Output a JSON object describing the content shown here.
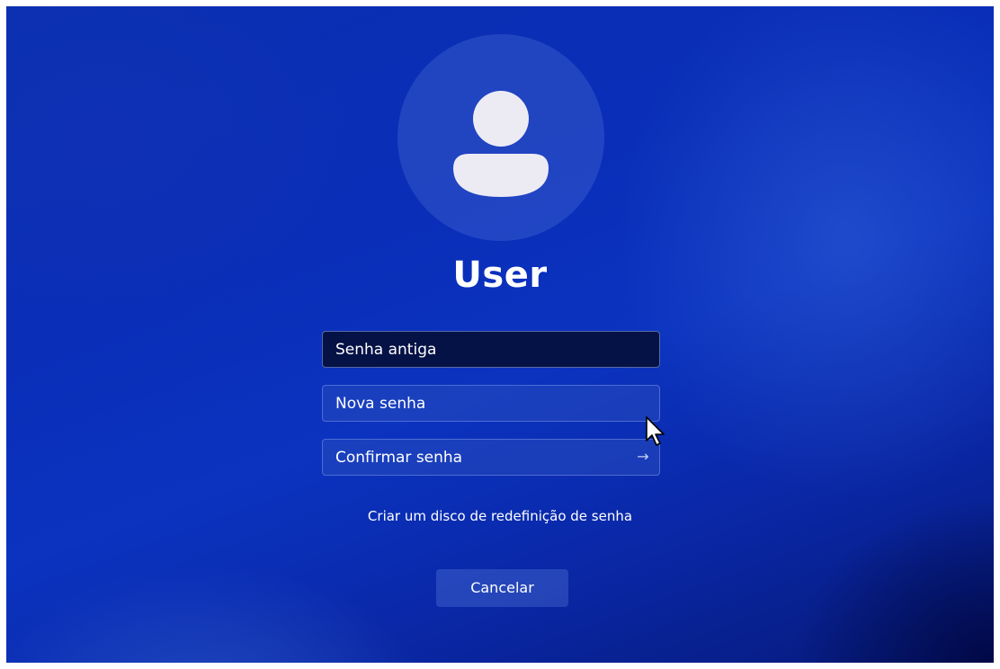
{
  "user": {
    "name": "User"
  },
  "form": {
    "old_password_placeholder": "Senha antiga",
    "new_password_placeholder": "Nova senha",
    "confirm_password_placeholder": "Confirmar senha",
    "submit_arrow": "→"
  },
  "links": {
    "reset_disk": "Criar um disco de redefinição de senha"
  },
  "buttons": {
    "cancel": "Cancelar"
  },
  "icons": {
    "avatar": "user-silhouette-icon",
    "submit": "arrow-right-icon",
    "pointer": "mouse-cursor-icon"
  },
  "colors": {
    "background": "#0a2eb8",
    "active_field": "#040f3c",
    "text": "#ffffff"
  }
}
